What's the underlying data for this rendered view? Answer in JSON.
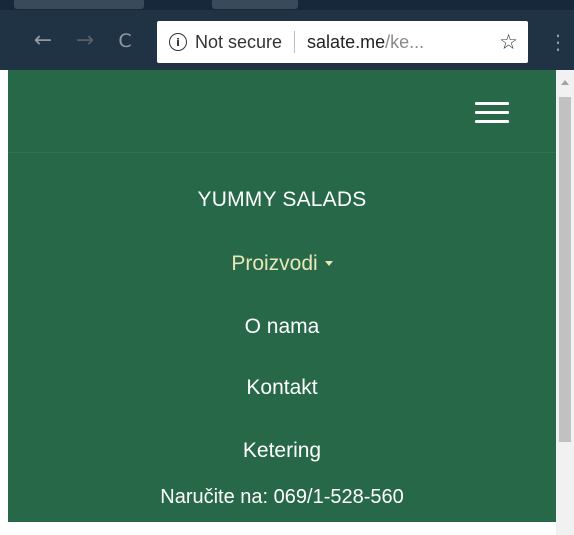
{
  "browser": {
    "back_icon": "←",
    "forward_icon": "→",
    "reload_icon": "C",
    "security_label": "Not secure",
    "url_domain": "salate.me",
    "url_path": "/ke...",
    "star_icon": "☆",
    "menu_icon": "⋮"
  },
  "site": {
    "background_color": "#266848",
    "brand": "YUMMY SALADS",
    "nav": {
      "products": "Proizvodi",
      "about": "O nama",
      "contact": "Kontakt",
      "catering": "Ketering"
    },
    "order_text": "Naručite na: 069/1-528-560"
  }
}
